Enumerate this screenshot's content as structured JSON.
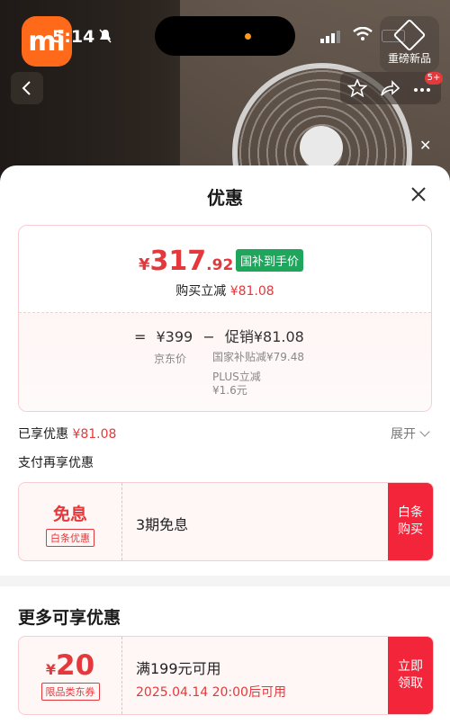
{
  "status_bar": {
    "time": "5:14",
    "battery": "77"
  },
  "header": {
    "new_badge": "重磅新品",
    "more_count": "5+"
  },
  "sheet": {
    "title": "优惠"
  },
  "price": {
    "currency": "¥",
    "integer": "317",
    "decimal": ".92",
    "subsidy_tag": "国补到手价",
    "reduce_label": "购买立减",
    "reduce_amount": "¥81.08"
  },
  "calc": {
    "equals": "=",
    "base_price": "¥399",
    "minus": "−",
    "promo_label": "促销",
    "promo_amount": "¥81.08",
    "jd_price_label": "京东价",
    "subsidy_item": "国家补贴减¥79.48",
    "plus_label": "PLUS立减",
    "plus_amount": "¥1.6元"
  },
  "enjoyed": {
    "label": "已享优惠",
    "amount": "¥81.08",
    "expand": "展开"
  },
  "pay_section": {
    "title": "支付再享优惠"
  },
  "coupon_interest": {
    "big": "免息",
    "tag": "白条优惠",
    "desc": "3期免息",
    "button": "白条\n购买"
  },
  "more_section": {
    "title": "更多可享优惠"
  },
  "coupon_store": {
    "currency": "¥",
    "amount": "20",
    "tag": "限品类东券",
    "condition": "满199元可用",
    "time": "2025.04.14 20:00后可用",
    "button": "立即\n领取"
  },
  "colors": {
    "accent": "#e4393c",
    "button_red": "#f2253a",
    "subsidy_green": "#1ea65d"
  }
}
